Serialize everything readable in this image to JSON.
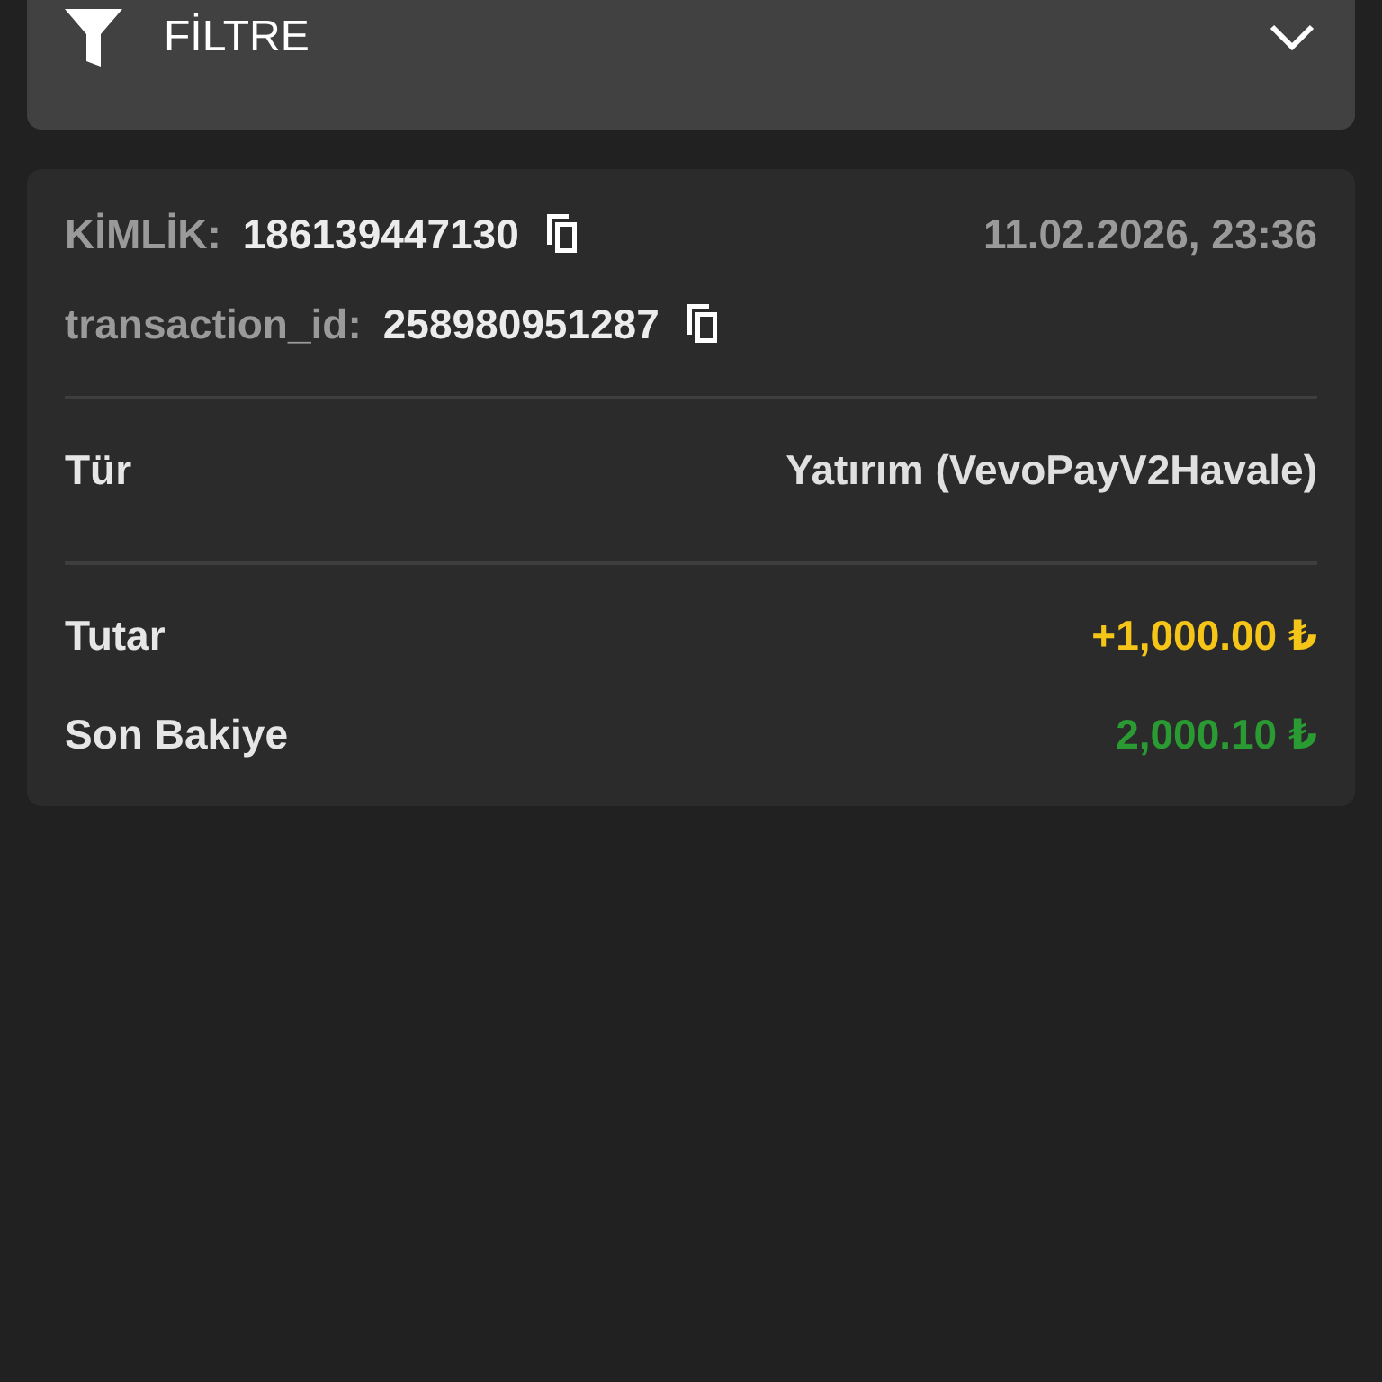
{
  "filter": {
    "label": "FİLTRE",
    "expanded": false
  },
  "transaction": {
    "id_label": "KİMLİK:",
    "id_value": "186139447130",
    "date": "11.02.2026, 23:36",
    "tx_label": "transaction_id:",
    "tx_value": "258980951287",
    "sections": [
      [
        {
          "label": "Tür",
          "value": "Yatırım (VevoPayV2Havale)",
          "color": "#e0e0e0"
        }
      ],
      [
        {
          "label": "Tutar",
          "value": "+1,000.00 ₺",
          "color": "#f5c518"
        },
        {
          "label": "Son Bakiye",
          "value": "2,000.10 ₺",
          "color": "#2a9a32"
        }
      ]
    ]
  }
}
